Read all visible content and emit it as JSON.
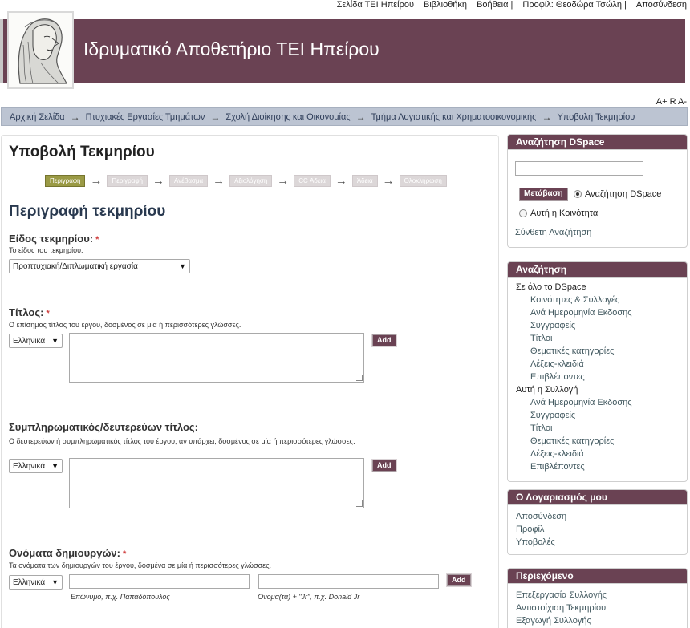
{
  "top_links": [
    "Σελίδα ΤΕΙ Ηπείρου",
    "Βιβλιοθήκη",
    "Βοήθεια |",
    "Προφίλ: Θεοδώρα Τσώλη |",
    "Αποσύνδεση"
  ],
  "header": {
    "title": "Ιδρυματικό Αποθετήριο ΤΕΙ Ηπείρου",
    "logo_icon": "greek-statue-logo"
  },
  "font_sizer": "A+ R A-",
  "breadcrumb": [
    "Αρχική Σελίδα",
    "Πτυχιακές Εργασίες Τμημάτων",
    "Σχολή Διοίκησης και Οικονομίας",
    "Τμήμα Λογιστικής και Χρηματοοικονομικής",
    "Υποβολή Τεκμηρίου"
  ],
  "main": {
    "title": "Υποβολή Τεκμηρίου",
    "progress_steps": [
      "Περιγραφή",
      "Περιγραφή",
      "Ανέβασμα",
      "Αξιολόγηση",
      "CC Άδεια",
      "Άδεια",
      "Ολοκλήρωση"
    ],
    "section_title": "Περιγραφή τεκμηρίου",
    "fields": {
      "type": {
        "label": "Είδος τεκμηρίου:",
        "help": "Το είδος του τεκμηρίου.",
        "value": "Προπτυχιακή/Διπλωματική εργασία"
      },
      "title": {
        "label": "Τίτλος:",
        "help": "Ο επίσημος τίτλος του έργου, δοσμένος σε μία ή περισσότερες γλώσσες.",
        "lang": "Ελληνικά",
        "add": "Add"
      },
      "subtitle": {
        "label": "Συμπληρωματικός/δευτερεύων τίτλος:",
        "help": "Ο δευτερεύων ή συμπληρωματικός τίτλος του έργου, αν υπάρχει, δοσμένος σε μία ή περισσότερες γλώσσες.",
        "lang": "Ελληνικά",
        "add": "Add"
      },
      "creators": {
        "label": "Ονόματα δημιουργών:",
        "help": "Τα ονόματα των δημιουργών του έργου, δοσμένα σε μία ή περισσότερες γλώσσες.",
        "lang": "Ελληνικά",
        "add": "Add",
        "lastname_hint": "Επώνυμο, π.χ. Παπαδόπουλος",
        "firstname_hint": "Όνομα(τα) + \"Jr\", π.χ. Donald Jr"
      }
    },
    "required_mark": "*"
  },
  "sidebar": {
    "search": {
      "title": "Αναζήτηση DSpace",
      "go": "Μετάβαση",
      "scope_all": "Αναζήτηση DSpace",
      "scope_community": "Αυτή η Κοινότητα",
      "advanced": "Σύνθετη Αναζήτηση"
    },
    "browse": {
      "title": "Αναζήτηση",
      "all_label": "Σε όλο το DSpace",
      "all_items": [
        "Κοινότητες & Συλλογές",
        "Ανά Ημερομηνία Εκδοσης",
        "Συγγραφείς",
        "Τίτλοι",
        "Θεματικές κατηγορίες",
        "Λέξεις-κλειδιά",
        "Επιβλέποντες"
      ],
      "collection_label": "Αυτή η Συλλογή",
      "collection_items": [
        "Ανά Ημερομηνία Εκδοσης",
        "Συγγραφείς",
        "Τίτλοι",
        "Θεματικές κατηγορίες",
        "Λέξεις-κλειδιά",
        "Επιβλέποντες"
      ]
    },
    "account": {
      "title": "Ο Λογαριασμός μου",
      "items": [
        "Αποσύνδεση",
        "Προφίλ",
        "Υποβολές"
      ]
    },
    "context": {
      "title": "Περιεχόμενο",
      "items": [
        "Επεξεργασία Συλλογής",
        "Αντιστοίχιση Τεκμηρίου",
        "Εξαγωγή Συλλογής"
      ]
    }
  }
}
